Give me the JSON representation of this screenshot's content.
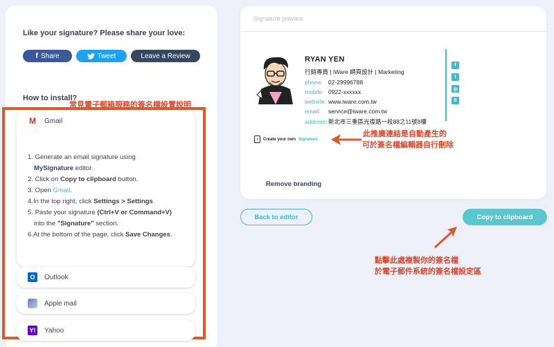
{
  "share": {
    "title": "Like your signature? Please share your love:",
    "facebook_icon": "f",
    "facebook": "Share",
    "twitter": "Tweet",
    "review": "Leave a Review"
  },
  "install": {
    "title": "How to install?",
    "annotation": "常見電子郵箱服務的簽名檔設置說明",
    "clients": [
      {
        "name": "Gmail",
        "icon": "M"
      },
      {
        "name": "Outlook",
        "icon": "O"
      },
      {
        "name": "Apple mail",
        "icon": ""
      },
      {
        "name": "Yahoo",
        "icon": "Y!"
      }
    ],
    "steps": [
      {
        "num": "1.",
        "text": "Generate an email signature using"
      },
      {
        "bold": "MySignature",
        "text": " editor."
      },
      {
        "num": "2.",
        "pre": "Click on ",
        "bold": "Copy to clipboard",
        "text": " button."
      },
      {
        "num": "3.",
        "pre": "Open ",
        "link": "Gmail",
        "text": "."
      },
      {
        "num": "4.",
        "pre": "In the top right, click ",
        "bold": "Settings > Settings",
        "text": "."
      },
      {
        "num": "5.",
        "pre": "Paste your signature ",
        "bold": "(Ctrl+V or Command+V)"
      },
      {
        "pre": "into the ",
        "bold": "\"Signature\"",
        "text": " section."
      },
      {
        "num": "6.",
        "pre": "At the bottom of the page, click ",
        "bold": "Save Changes",
        "text": "."
      }
    ]
  },
  "preview": {
    "label": "Signature preview",
    "name": "RYAN YEN",
    "role": "行銷專員 | iWare 網頁設計 | Marketing",
    "rows": [
      {
        "key": "phone:",
        "value": "02-29996788"
      },
      {
        "key": "mobile:",
        "value": "0922-xxxxxx"
      },
      {
        "key": "website:",
        "value": "www.iware.com.tw"
      },
      {
        "key": "email:",
        "value": "service@iware.com.tw"
      },
      {
        "key": "address:",
        "value": "新北市三重區光復路一段88之11號8樓"
      }
    ],
    "social_icons": [
      "f",
      "t",
      "◎",
      "S"
    ],
    "branding_prefix": "Create your own",
    "branding_accent": "Signature",
    "remove_branding": "Remove branding"
  },
  "annotations": {
    "branding_line1": "此推廣連結是自動產生的",
    "branding_line2": "可於簽名檔編輯器自行刪除",
    "copy_line1": "點擊此處複製你的簽名檔",
    "copy_line2": "於電子郵件系統的簽名檔設定區"
  },
  "actions": {
    "back": "Back to editor",
    "copy": "Copy to clipboard"
  },
  "colors": {
    "accent": "#4ab5c4",
    "annotation": "#d9472b",
    "facebook": "#3b5999",
    "twitter": "#1da1f2",
    "review": "#34495e"
  }
}
